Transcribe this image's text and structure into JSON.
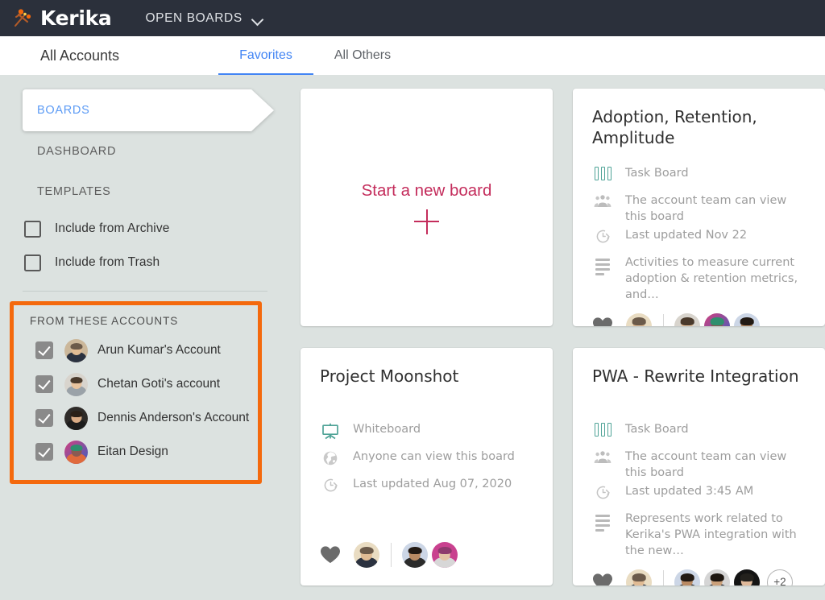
{
  "header": {
    "brand": "Kerika",
    "logo_icon": "kerika-logo-icon",
    "boards_menu_label": "OPEN BOARDS",
    "caret_icon": "chevron-down-icon"
  },
  "subheader": {
    "account_scope_label": "All Accounts",
    "tabs": [
      {
        "label": "Favorites",
        "active": true
      },
      {
        "label": "All Others",
        "active": false
      }
    ]
  },
  "sidebar": {
    "nav": [
      {
        "label": "BOARDS",
        "active": true
      },
      {
        "label": "DASHBOARD",
        "active": false
      },
      {
        "label": "TEMPLATES",
        "active": false
      }
    ],
    "filters": [
      {
        "label": "Include from Archive",
        "checked": false
      },
      {
        "label": "Include from Trash",
        "checked": false
      }
    ],
    "accounts_panel": {
      "title": "FROM THESE ACCOUNTS",
      "highlight_color": "#f4690d",
      "accounts": [
        {
          "name": "Arun Kumar's Account",
          "checked": true
        },
        {
          "name": "Chetan Goti's account",
          "checked": true
        },
        {
          "name": "Dennis Anderson's Account",
          "checked": true
        },
        {
          "name": "Eitan Design",
          "checked": true
        }
      ]
    }
  },
  "main": {
    "new_board_card": {
      "label": "Start a new board",
      "plus_icon": "plus-icon"
    },
    "boards": [
      {
        "title": "Adoption, Retention, Amplitude",
        "type_icon": "task-board-icon",
        "type": "Task Board",
        "privacy_icon": "people-icon",
        "privacy": "The account team can view this board",
        "updated_icon": "history-clock-icon",
        "updated": "Last updated Nov 22",
        "description_icon": "description-lines-icon",
        "description": "Activities to measure current adoption & retention metrics, and…",
        "favorite_icon": "heart-icon",
        "favorite": true,
        "owner_avatar": "arun-kumar-avatar",
        "team_avatars": [
          "chetan-goti-avatar",
          "eitan-design-avatar",
          "team-member-avatar"
        ],
        "overflow_count": ""
      },
      {
        "title": "Project Moonshot",
        "type_icon": "whiteboard-icon",
        "type": "Whiteboard",
        "privacy_icon": "globe-icon",
        "privacy": "Anyone can view this board",
        "updated_icon": "history-clock-icon",
        "updated": "Last updated Aug 07, 2020",
        "description_icon": "",
        "description": "",
        "favorite_icon": "heart-icon",
        "favorite": true,
        "owner_avatar": "arun-kumar-avatar",
        "team_avatars": [
          "team-member-avatar",
          "team-member-avatar"
        ],
        "overflow_count": ""
      },
      {
        "title": "PWA - Rewrite Integration",
        "type_icon": "task-board-icon",
        "type": "Task Board",
        "privacy_icon": "people-icon",
        "privacy": "The account team can view this board",
        "updated_icon": "history-clock-icon",
        "updated": "Last updated 3:45 AM",
        "description_icon": "description-lines-icon",
        "description": "Represents work related to Kerika's PWA integration with the new…",
        "favorite_icon": "heart-icon",
        "favorite": true,
        "owner_avatar": "arun-kumar-avatar",
        "team_avatars": [
          "team-member-avatar",
          "team-member-avatar",
          "team-member-avatar"
        ],
        "overflow_count": "+2"
      }
    ]
  },
  "colors": {
    "topbar": "#2b303b",
    "page_background": "#dce2e0",
    "accent_blue": "#4285f4",
    "accent_pink": "#c42d5c",
    "accent_teal": "#4fa397",
    "highlight_orange": "#f4690d"
  }
}
